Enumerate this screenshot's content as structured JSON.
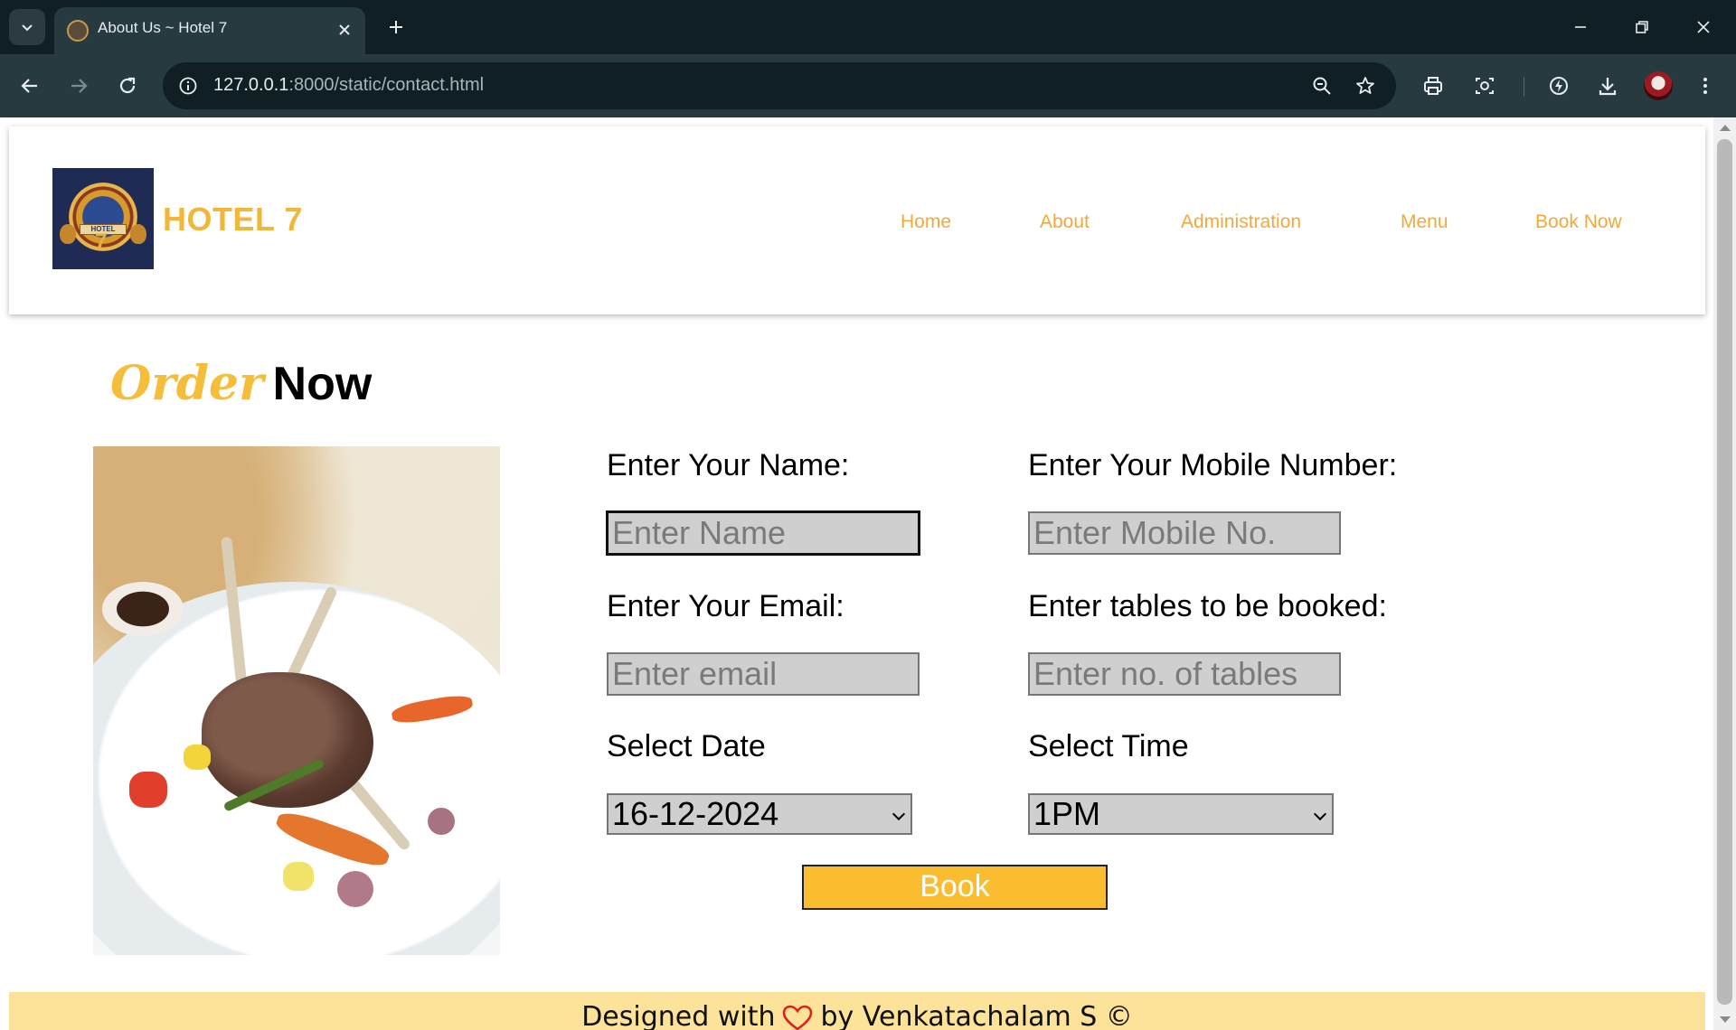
{
  "browser": {
    "tab_title": "About Us ~ Hotel 7",
    "url_host": "127.0.0.1",
    "url_rest": ":8000/static/contact.html",
    "icons": [
      "tab-search-icon",
      "close-icon",
      "new-tab-icon",
      "minimize-icon",
      "restore-icon",
      "window-close-icon",
      "back-icon",
      "forward-icon",
      "reload-icon",
      "site-info-icon",
      "zoom-icon",
      "bookmark-star-icon",
      "print-icon",
      "screenshot-icon",
      "performance-icon",
      "download-icon",
      "profile-avatar",
      "menu-kebab-icon"
    ]
  },
  "site": {
    "brand": "HOTEL 7",
    "logo_banner": "HOTEL",
    "logo_number": "7",
    "nav": [
      "Home",
      "About",
      "Administration",
      "Menu",
      "Book Now"
    ],
    "accent_color": "#f0b73a"
  },
  "order": {
    "title_part1": "Order",
    "title_part2": "Now"
  },
  "form": {
    "name_label": "Enter Your Name:",
    "name_placeholder": "Enter Name",
    "mobile_label": "Enter Your Mobile Number:",
    "mobile_placeholder": "Enter Mobile No.",
    "email_label": "Enter Your Email:",
    "email_placeholder": "Enter email",
    "tables_label": "Enter tables to be booked:",
    "tables_placeholder": "Enter no. of tables",
    "date_label": "Select Date",
    "date_value": "16-12-2024",
    "time_label": "Select Time",
    "time_value": "1PM",
    "book_label": "Book",
    "button_color": "#f9bd2f"
  },
  "footer": {
    "prefix": "Designed with",
    "suffix": "by Venkatachalam S ©",
    "heart_color": "#e02020",
    "background": "#fde39a"
  }
}
